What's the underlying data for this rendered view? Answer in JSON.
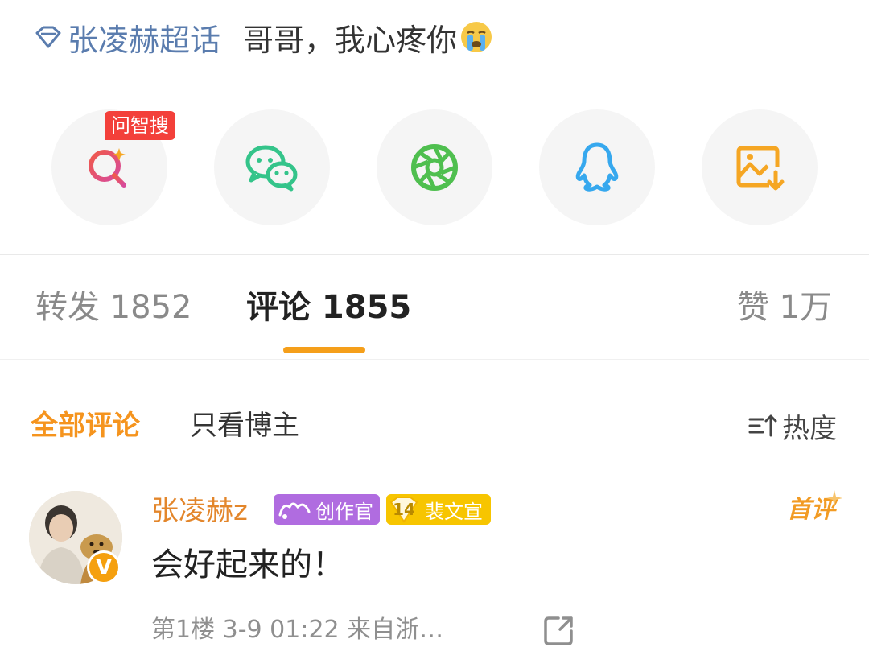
{
  "post": {
    "topic": "张凌赫超话",
    "text": "哥哥，我心疼你",
    "emoji": "crying-face-emoji"
  },
  "share": {
    "ai_badge": "问智搜",
    "buttons": [
      "ai-search",
      "wechat",
      "moments",
      "qq",
      "save-image"
    ],
    "colors": {
      "ai_search_start": "#f05a4a",
      "ai_search_end": "#d74a9b",
      "wechat": "#34c48a",
      "moments": "#4fbf4f",
      "qq": "#36a8ee",
      "save_image": "#f5a623"
    }
  },
  "tabs": {
    "repost": "转发 1852",
    "comment": "评论 1855",
    "like": "赞 1万"
  },
  "filters": {
    "all": "全部评论",
    "author_only": "只看博主",
    "sort": "热度"
  },
  "comment": {
    "username": "张凌赫z",
    "badge_creator": "创作官",
    "badge_fan_level": "14",
    "badge_fan_name": "裴文宣",
    "first_tag": "首评",
    "text": "会好起来的！",
    "meta": "第1楼  3-9 01:22  来自浙…",
    "verified_mark": "V"
  },
  "theme": {
    "accent": "#f59f1a",
    "link": "#5a7cae",
    "username_color": "#e3862b"
  }
}
